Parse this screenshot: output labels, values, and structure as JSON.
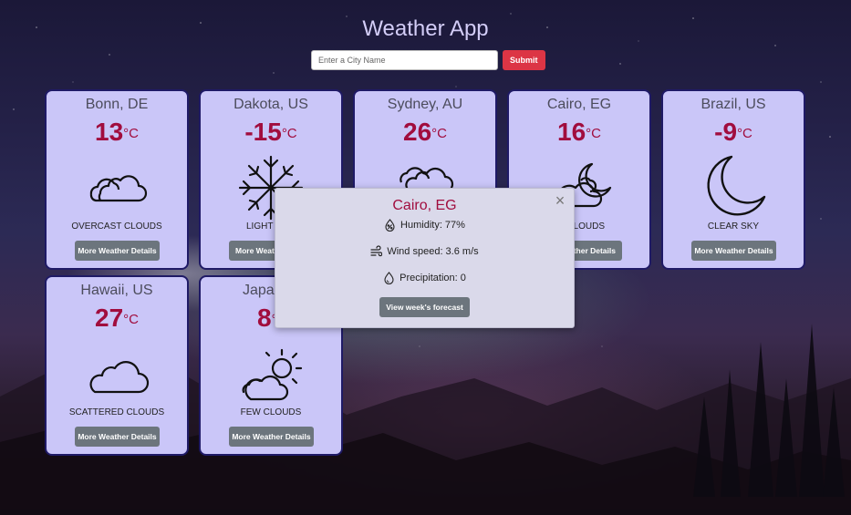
{
  "app": {
    "title": "Weather App"
  },
  "search": {
    "placeholder": "Enter a City Name",
    "value": "",
    "submit_label": "Submit"
  },
  "cards": [
    {
      "city": "Bonn, DE",
      "temp": "13",
      "unit": "°C",
      "description": "OVERCAST CLOUDS",
      "icon": "cloud-pair-icon",
      "button": "More Weather Details"
    },
    {
      "city": "Dakota, US",
      "temp": "-15",
      "unit": "°C",
      "description": "LIGHT S",
      "icon": "snowflake-icon",
      "button": "More Weath"
    },
    {
      "city": "Sydney, AU",
      "temp": "26",
      "unit": "°C",
      "description": "",
      "icon": "clouds-icon",
      "button": ""
    },
    {
      "city": "Cairo, EG",
      "temp": "16",
      "unit": "°C",
      "description": "CLOUDS",
      "icon": "moon-cloud-icon",
      "button": "ather Details"
    },
    {
      "city": "Brazil, US",
      "temp": "-9",
      "unit": "°C",
      "description": "CLEAR SKY",
      "icon": "moon-icon",
      "button": "More Weather Details"
    },
    {
      "city": "Hawaii, US",
      "temp": "27",
      "unit": "°C",
      "description": "SCATTERED CLOUDS",
      "icon": "cloud-icon",
      "button": "More Weather Details"
    },
    {
      "city": "Japan",
      "temp": "8",
      "unit": "°C",
      "description": "FEW CLOUDS",
      "icon": "sun-cloud-icon",
      "button": "More Weather Details"
    }
  ],
  "popup": {
    "city": "Cairo, EG",
    "humidity": "Humidity: 77%",
    "wind": "Wind speed: 3.6 m/s",
    "precipitation": "Precipitation: 0",
    "button": "View week's forecast",
    "close_glyph": "×"
  },
  "colors": {
    "card_bg": "#cac6f8",
    "card_border": "#1f1a66",
    "temp": "#a10d3e",
    "submit": "#dc3545",
    "button": "#6c757d"
  }
}
